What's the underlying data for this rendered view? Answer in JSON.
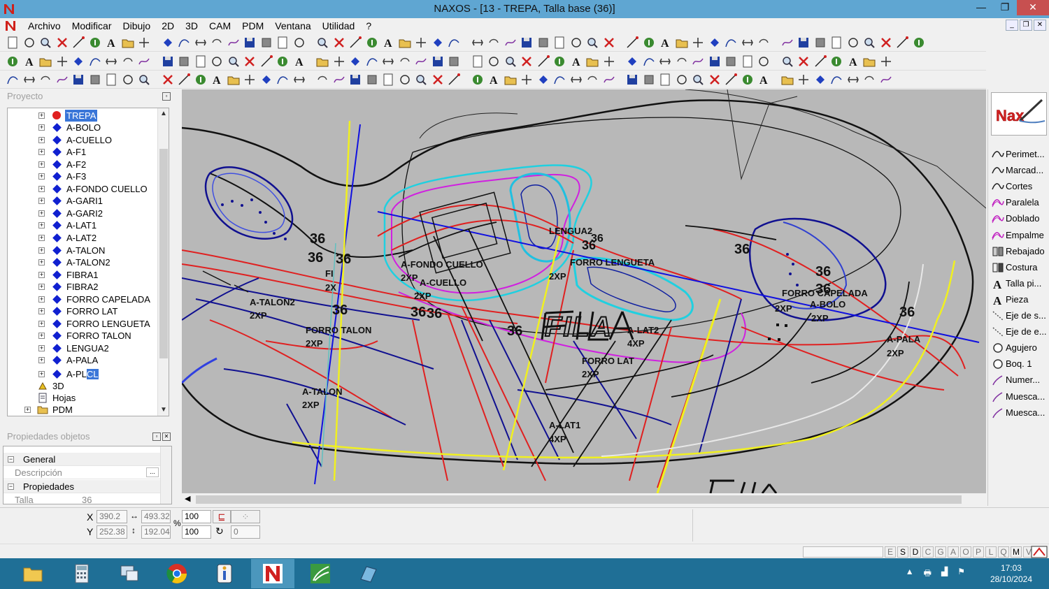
{
  "window": {
    "title": "NAXOS - [13 - TREPA, Talla base (36)]",
    "app_icon": "naxos-n-icon"
  },
  "menu": [
    "Archivo",
    "Modificar",
    "Dibujo",
    "2D",
    "3D",
    "CAM",
    "PDM",
    "Ventana",
    "Utilidad",
    "?"
  ],
  "project_panel": {
    "title": "Proyecto",
    "root": "TREPA",
    "items": [
      "A-BOLO",
      "A-CUELLO",
      "A-F1",
      "A-F2",
      "A-F3",
      "A-FONDO CUELLO",
      "A-GARI1",
      "A-GARI2",
      "A-LAT1",
      "A-LAT2",
      "A-TALON",
      "A-TALON2",
      "FIBRA1",
      "FIBRA2",
      "FORRO CAPELADA",
      "FORRO LAT",
      "FORRO LENGUETA",
      "FORRO TALON",
      "LENGUA2",
      "A-PALA"
    ],
    "editing_item": {
      "prefix": "A-PL",
      "selected": "CL"
    },
    "other_nodes": [
      "3D",
      "Hojas",
      "PDM"
    ]
  },
  "properties_panel": {
    "title": "Propiedades objetos",
    "groups": [
      "General",
      "Propiedades"
    ],
    "fields": [
      {
        "name": "Descripción",
        "value": ""
      },
      {
        "name": "Talla",
        "value": "36"
      }
    ],
    "dots_button": "..."
  },
  "canvas": {
    "labels": [
      {
        "text": "36"
      },
      {
        "text": "36"
      },
      {
        "text": "36"
      },
      {
        "text": "36"
      },
      {
        "text": "36"
      },
      {
        "text": "36"
      },
      {
        "text": "36"
      },
      {
        "text": "36"
      },
      {
        "text": "36"
      },
      {
        "text": "36"
      },
      {
        "text": "36"
      },
      {
        "text": "36"
      },
      {
        "text": "36"
      },
      {
        "text": "A-TALON2"
      },
      {
        "text": "2XP"
      },
      {
        "text": "FI"
      },
      {
        "text": "2X"
      },
      {
        "text": "A-FONDO CUELLO"
      },
      {
        "text": "2XP"
      },
      {
        "text": "A-CUELLO"
      },
      {
        "text": "2XP"
      },
      {
        "text": "LENGUA2"
      },
      {
        "text": "FORRO LENGUETA"
      },
      {
        "text": "2XP"
      },
      {
        "text": "FORRO TALON"
      },
      {
        "text": "2XP"
      },
      {
        "text": "A-LAT2"
      },
      {
        "text": "4XP"
      },
      {
        "text": "FORRO LAT"
      },
      {
        "text": "2XP"
      },
      {
        "text": "A-TALON"
      },
      {
        "text": "2XP"
      },
      {
        "text": "A-LAT1"
      },
      {
        "text": "4XP"
      },
      {
        "text": "FORRO CAPELADA"
      },
      {
        "text": "A-BOLO"
      },
      {
        "text": "2XP"
      },
      {
        "text": "2XP"
      },
      {
        "text": "A-PALA"
      },
      {
        "text": "2XP"
      },
      {
        "text": "FILA"
      }
    ]
  },
  "right_panel": {
    "logo": "Nax",
    "buttons": [
      "Perimet...",
      "Marcad...",
      "Cortes",
      "Paralela",
      "Doblado",
      "Empalme",
      "Rebajado",
      "Costura",
      "Talla pi...",
      "Pieza",
      "Eje de s...",
      "Eje de e...",
      "Agujero",
      "Boq. 1",
      "Numer...",
      "Muesca...",
      "Muesca..."
    ],
    "button_icons": [
      "curve-icon",
      "curve-icon",
      "curve-icon",
      "double-curve-icon",
      "double-curve-icon",
      "double-curve-icon",
      "rebajado-icon",
      "stitch-icon",
      "text-a-icon",
      "text-a-icon",
      "axis-icon",
      "axis-icon",
      "circle-icon",
      "circle-icon",
      "pen-icon",
      "pen-icon",
      "pen-icon"
    ]
  },
  "coords": {
    "x_label": "X",
    "y_label": "Y",
    "x": "390.2",
    "y": "252.38",
    "width": "493.32",
    "height": "192.04",
    "pct_symbol": "%",
    "scale_x": "100",
    "scale_y": "100",
    "rotation": "0"
  },
  "status_letters": [
    "E",
    "S",
    "D",
    "C",
    "G",
    "A",
    "O",
    "P",
    "L",
    "Q",
    "M",
    "V"
  ],
  "status_letters_on": [
    "S",
    "D",
    "M"
  ],
  "taskbar": {
    "apps": [
      "file-explorer-icon",
      "calculator-icon",
      "network-icon",
      "chrome-icon",
      "app-i-icon",
      "naxos-icon",
      "green-app-icon",
      "blue-app-icon"
    ],
    "time": "17:03",
    "date": "28/10/2024"
  },
  "colors": {
    "titlebar": "#5fa6d2",
    "taskbar": "#1f6f96",
    "canvas": "#b8b8b8",
    "selection": "#3a76d8"
  }
}
